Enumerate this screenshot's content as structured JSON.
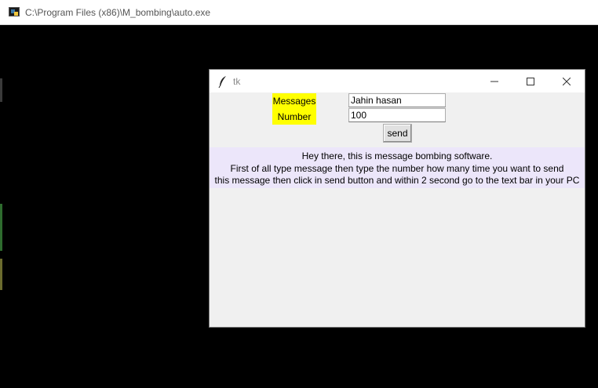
{
  "console": {
    "title": "C:\\Program Files (x86)\\M_bombing\\auto.exe"
  },
  "tk_window": {
    "title": "tk",
    "controls": {
      "minimize": "—",
      "maximize": "☐",
      "close": "✕"
    },
    "form": {
      "messages_label": "Messages",
      "messages_value": "Jahin hasan",
      "number_label": "Number",
      "number_value": "100",
      "send_label": "send"
    },
    "info_lines": [
      "Hey there, this is message bombing software.",
      "First of all type message then type the number how many time you want to send",
      "this message then click in send button and within 2 second go to the text bar in your PC"
    ]
  },
  "colors": {
    "label_bg": "#ffff00",
    "info_bg": "#ece6fa",
    "window_bg": "#f0f0f0",
    "desktop_bg": "#000000"
  }
}
